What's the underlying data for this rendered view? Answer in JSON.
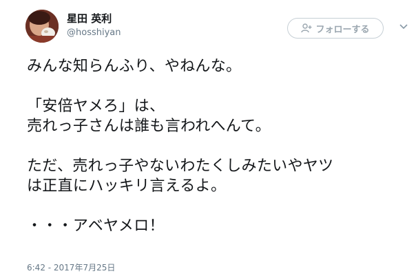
{
  "user": {
    "display_name": "星田 英利",
    "handle": "@hosshiyan"
  },
  "follow_button": {
    "label": "フォローする",
    "icon": "add-user-icon"
  },
  "menu": {
    "icon": "chevron-down-icon"
  },
  "tweet": {
    "lines": [
      "みんな知らんふり、やねんな。",
      "「安倍ヤメろ」は、",
      "売れっ子さんは誰も言われへんて。",
      "ただ、売れっ子やないわたくしみたいやヤツ",
      "は正直にハッキリ言えるよ。",
      "・・・アベヤメロ！"
    ],
    "timestamp": "6:42 - 2017年7月25日"
  },
  "colors": {
    "text": "#14171a",
    "secondary": "#657786",
    "button_border": "#c6cfd5"
  }
}
